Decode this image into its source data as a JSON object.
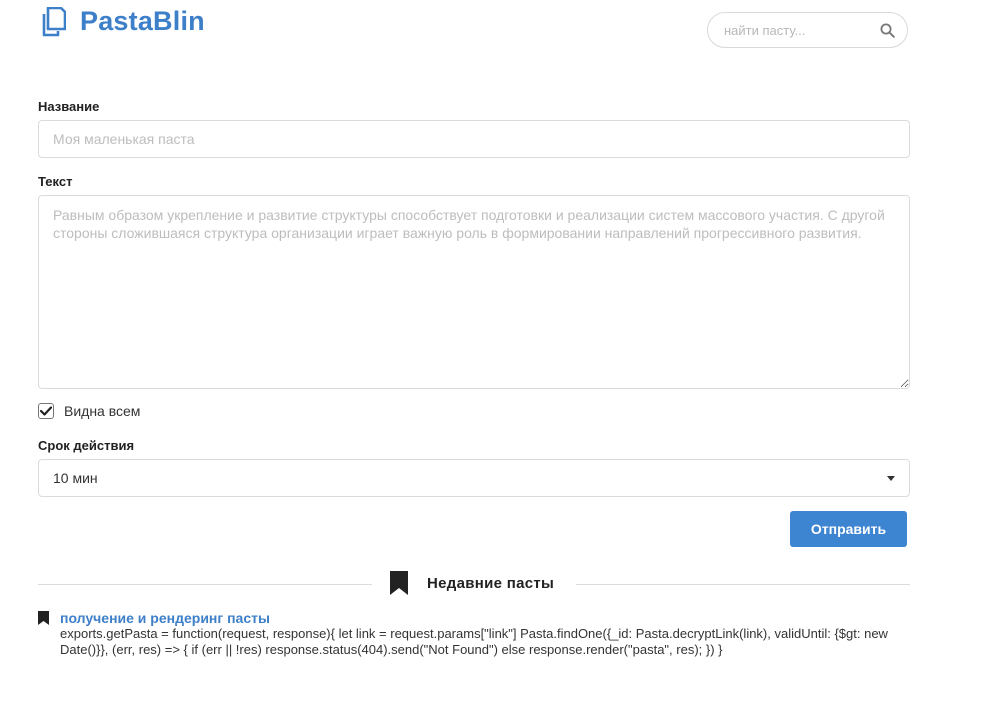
{
  "app": {
    "name": "PastaBlin"
  },
  "search": {
    "placeholder": "найти пасту..."
  },
  "form": {
    "title_label": "Название",
    "title_placeholder": "Моя маленькая паста",
    "text_label": "Текст",
    "text_placeholder": "Равным образом укрепление и развитие структуры способствует подготовки и реализации систем массового участия. С другой стороны сложившаяся структура организации играет важную роль в формировании направлений прогрессивного развития.",
    "public_label": "Видна всем",
    "public_checked": true,
    "expiry_label": "Срок действия",
    "expiry_value": "10 мин",
    "submit_label": "Отправить"
  },
  "recent": {
    "title": "Недавние пасты",
    "items": [
      {
        "title": "получение и рендеринг пасты",
        "snippet": "exports.getPasta = function(request, response){ let link = request.params[\"link\"] Pasta.findOne({_id: Pasta.decryptLink(link), validUntil: {$gt: new Date()}}, (err, res) => { if (err || !res) response.status(404).send(\"Not Found\") else response.render(\"pasta\", res); }) }"
      }
    ]
  },
  "colors": {
    "brand": "#3d7fc9",
    "button": "#3d84d1"
  }
}
